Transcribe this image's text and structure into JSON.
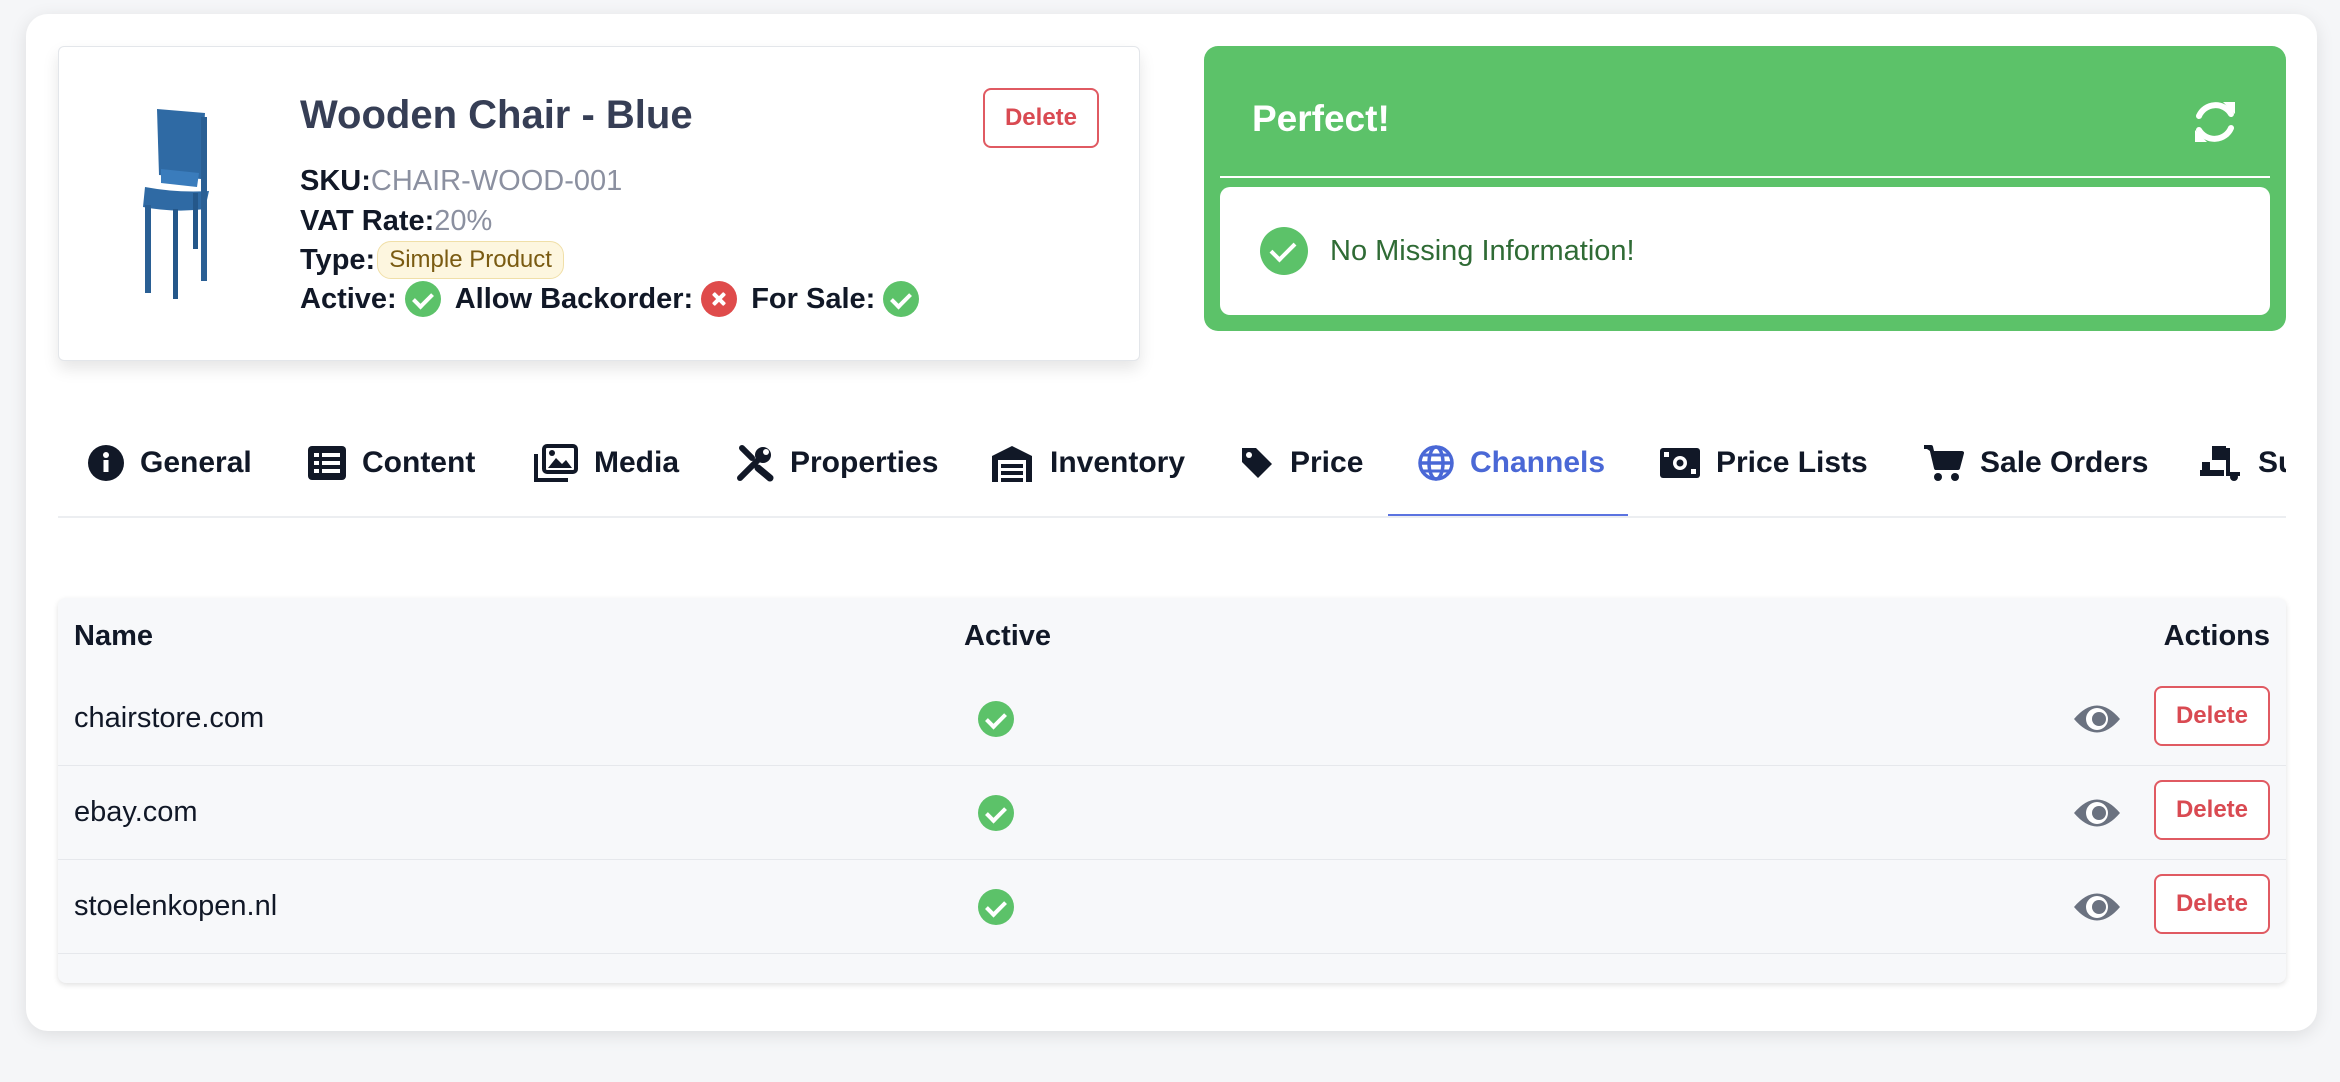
{
  "product": {
    "title": "Wooden Chair - Blue",
    "delete_label": "Delete",
    "sku_label": "SKU:",
    "sku": "CHAIR-WOOD-001",
    "vat_label": "VAT Rate:",
    "vat": "20%",
    "type_label": "Type:",
    "type": "Simple Product",
    "active_label": "Active:",
    "active": true,
    "backorder_label": "Allow Backorder:",
    "backorder": false,
    "for_sale_label": "For Sale:",
    "for_sale": true
  },
  "status": {
    "title": "Perfect!",
    "message": "No Missing Information!",
    "color": "#5cc269"
  },
  "tabs": [
    {
      "label": "General",
      "icon": "info-circle-icon"
    },
    {
      "label": "Content",
      "icon": "list-icon"
    },
    {
      "label": "Media",
      "icon": "images-icon"
    },
    {
      "label": "Properties",
      "icon": "tools-icon"
    },
    {
      "label": "Inventory",
      "icon": "warehouse-icon"
    },
    {
      "label": "Price",
      "icon": "tag-icon"
    },
    {
      "label": "Channels",
      "icon": "globe-icon",
      "active": true
    },
    {
      "label": "Price Lists",
      "icon": "money-bill-icon"
    },
    {
      "label": "Sale Orders",
      "icon": "cart-icon"
    },
    {
      "label": "Su",
      "icon": "truck-loading-icon"
    }
  ],
  "table": {
    "headers": {
      "name": "Name",
      "active": "Active",
      "actions": "Actions"
    },
    "rows": [
      {
        "name": "chairstore.com",
        "active": true,
        "delete_label": "Delete"
      },
      {
        "name": "ebay.com",
        "active": true,
        "delete_label": "Delete"
      },
      {
        "name": "stoelenkopen.nl",
        "active": true,
        "delete_label": "Delete"
      }
    ]
  },
  "colors": {
    "accent": "#4a68d6",
    "success": "#5cc269",
    "danger": "#d94a52"
  }
}
